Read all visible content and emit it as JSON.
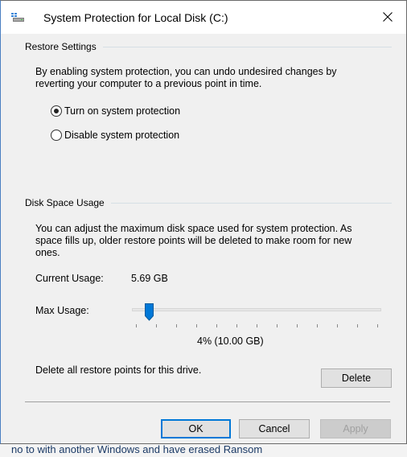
{
  "window": {
    "title": "System Protection for Local Disk (C:)",
    "icon": "disk-shield-icon"
  },
  "restore_settings": {
    "group_title": "Restore Settings",
    "description_line1": "By enabling system protection, you can undo undesired changes by",
    "description_line2": "reverting your computer to a previous point in time.",
    "options": [
      {
        "label": "Turn on system protection",
        "checked": true
      },
      {
        "label": "Disable system protection",
        "checked": false
      }
    ]
  },
  "disk_space": {
    "group_title": "Disk Space Usage",
    "description_line1": "You can adjust the maximum disk space used for system protection. As",
    "description_line2": "space fills up, older restore points will be deleted to make room for new",
    "description_line3": "ones.",
    "current_usage_label": "Current Usage:",
    "current_usage_value": "5.69 GB",
    "max_usage_label": "Max Usage:",
    "max_usage_percent": 4,
    "max_usage_readout": "4% (10.00 GB)",
    "delete_text": "Delete all restore points for this drive.",
    "delete_button": "Delete"
  },
  "footer": {
    "ok": "OK",
    "cancel": "Cancel",
    "apply": "Apply"
  },
  "background": {
    "text": "no to with another Windows and have erased Ransom"
  },
  "colors": {
    "dialog_bg": "#f0f0f0",
    "accent": "#0078d7",
    "disabled_text": "#a0a0a0"
  }
}
